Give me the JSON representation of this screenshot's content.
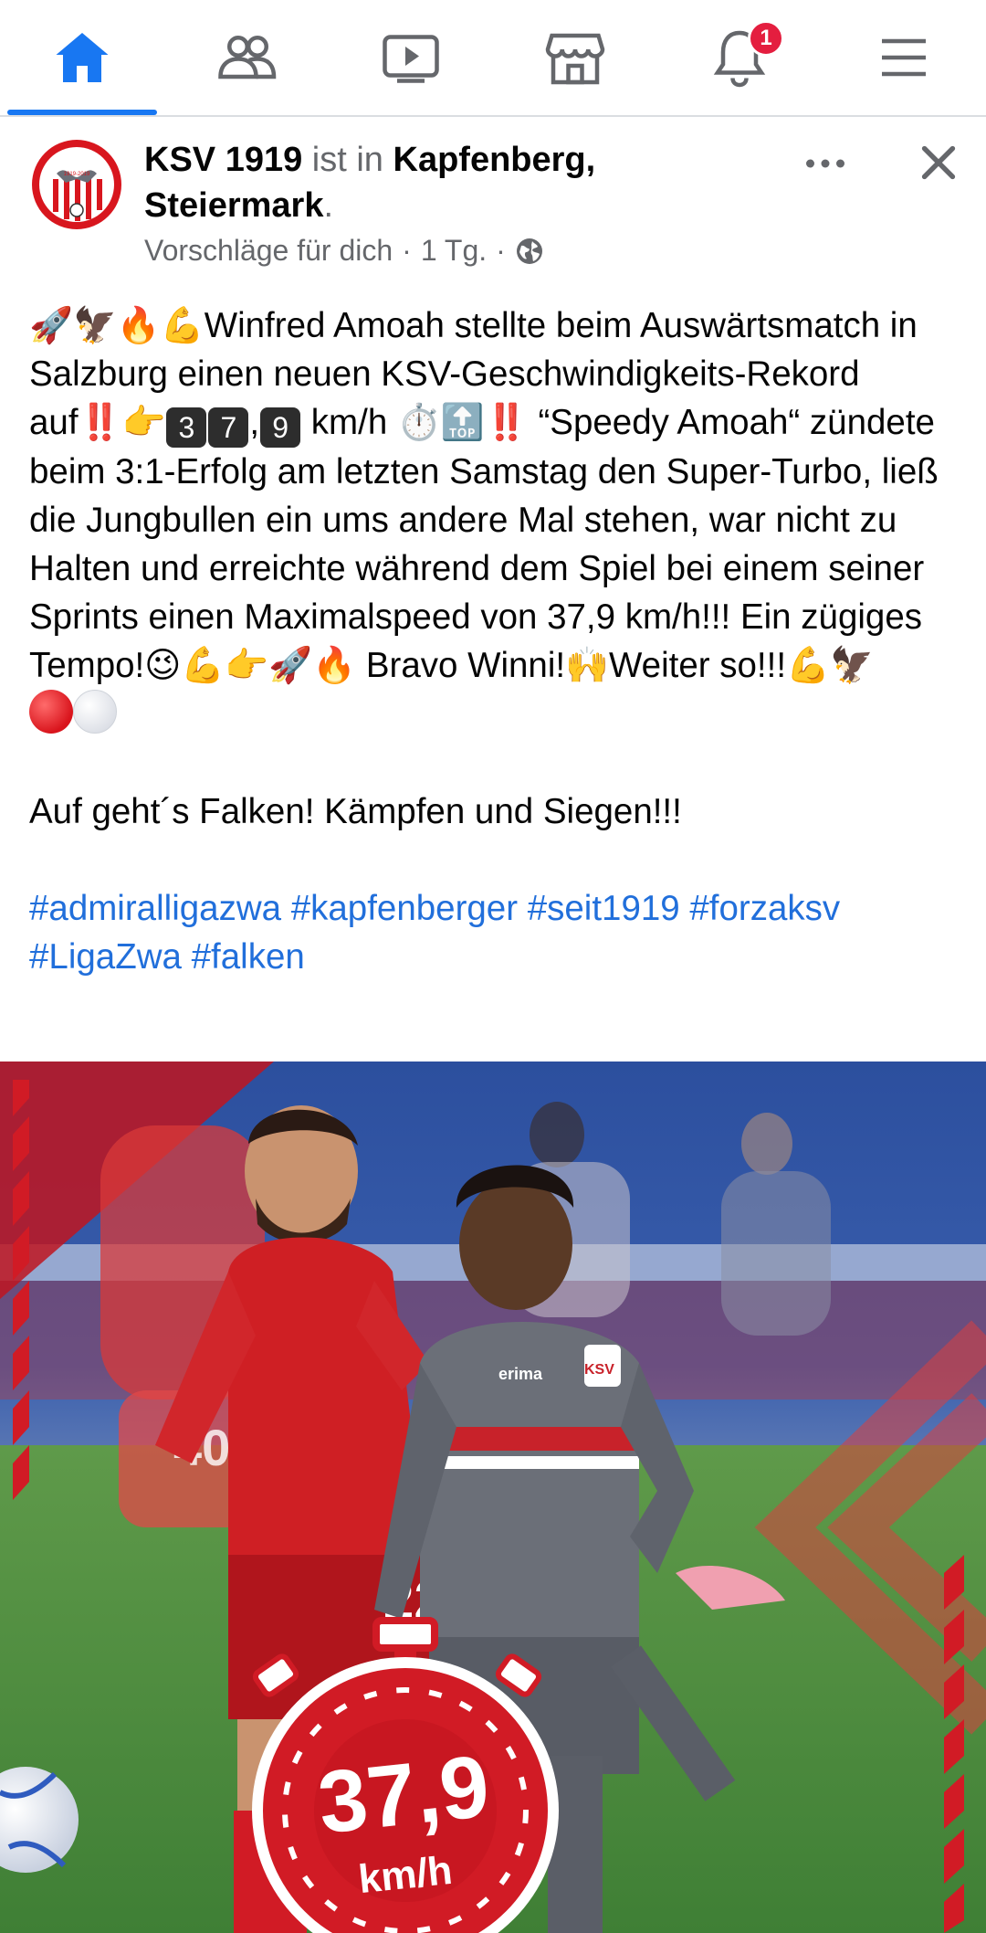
{
  "nav": {
    "items": [
      {
        "name": "home",
        "icon": "home-icon",
        "active": true
      },
      {
        "name": "friends",
        "icon": "friends-icon",
        "active": false
      },
      {
        "name": "watch",
        "icon": "video-icon",
        "active": false
      },
      {
        "name": "marketplace",
        "icon": "store-icon",
        "active": false
      },
      {
        "name": "notifications",
        "icon": "bell-icon",
        "active": false
      },
      {
        "name": "menu",
        "icon": "hamburger-menu-icon",
        "active": false
      }
    ],
    "notification_count": "1",
    "accent_color": "#1877f2",
    "badge_color": "#e41e3f"
  },
  "post": {
    "author": "KSV 1919",
    "connector": "ist in",
    "location": "Kapfenberg, Steiermark",
    "location_suffix": ".",
    "meta_source": "Vorschläge für dich",
    "meta_separator": "·",
    "meta_time": "1 Tg.",
    "privacy_icon": "globe-icon",
    "avatar_text": "KSV",
    "avatar_years": "1919-2019",
    "body": {
      "line1_text": "Winfred Amoah stellte beim Auswärtsmatch in Salzburg einen neuen KSV-Geschwindigkeits-Rekord auf",
      "speed_digits": [
        "3",
        "7",
        "9"
      ],
      "speed_comma": ",",
      "speed_unit": " km/h",
      "line2_text": " “Speedy Amoah“ zündete beim 3:1-Erfolg am letzten Samstag den Super-Turbo, ließ die Jungbullen ein ums andere Mal stehen, war nicht zu Halten und erreichte während dem Spiel bei einem seiner Sprints einen Maximalspeed von 37,9 km/h!!! Ein zügiges Tempo!",
      "line3_text": " Bravo Winni!",
      "line4_text": "Weiter so!!!",
      "closing": "Auf geht´s Falken! Kämpfen und Siegen!!!",
      "hashtags": "#admiralligazwa #kapfenberger #seit1919 #forzaksv #LigaZwa #falken"
    },
    "photo": {
      "speed_value": "37,9",
      "speed_unit": "km/h",
      "jersey_number_1": "22",
      "jersey_number_2": "40",
      "club_badge": "KSV",
      "sponsor_text": "erima"
    }
  }
}
